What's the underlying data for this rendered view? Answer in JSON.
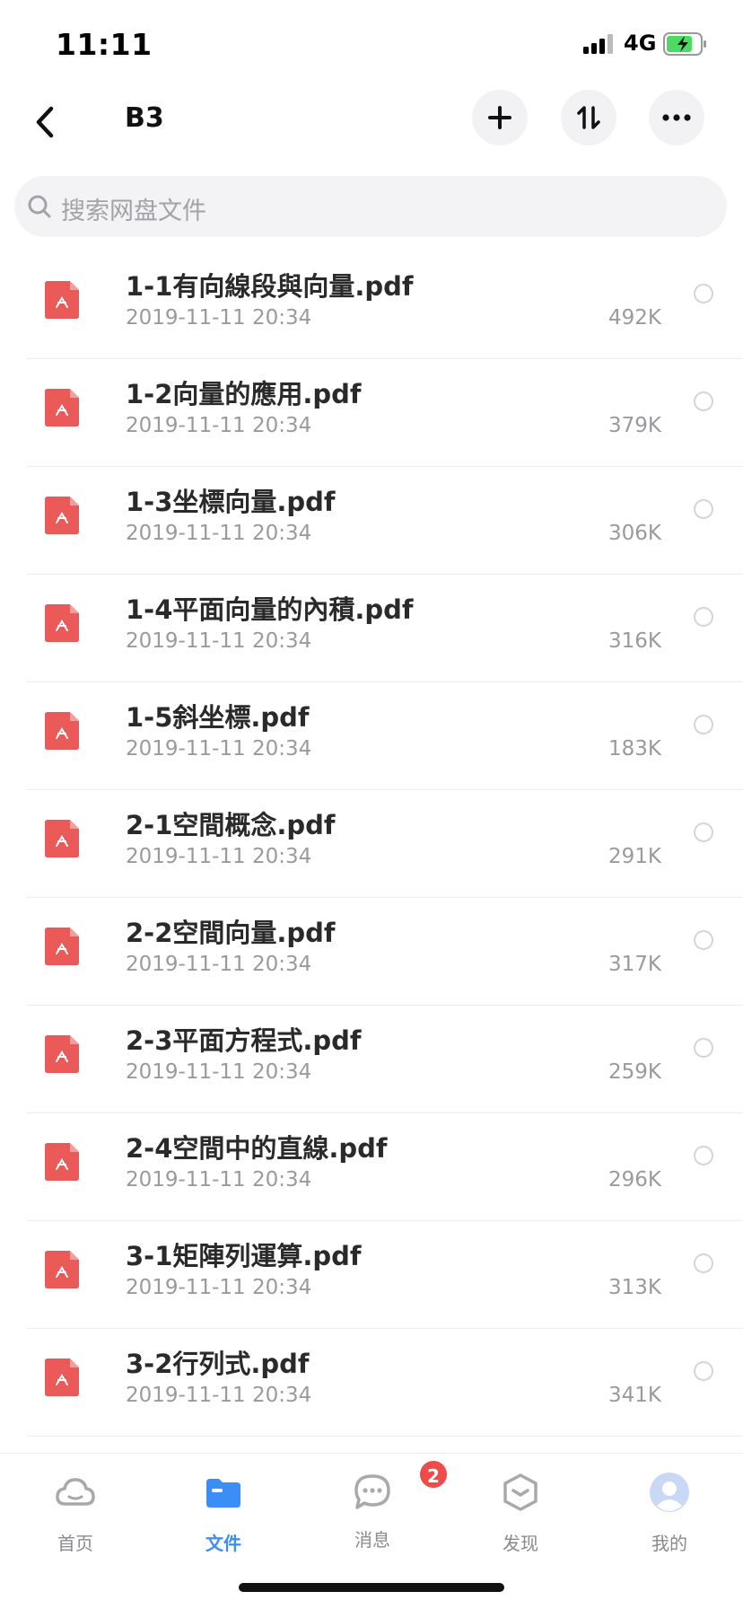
{
  "status_bar": {
    "time": "11:11",
    "network": "4G"
  },
  "nav": {
    "title": "B3"
  },
  "search": {
    "placeholder": "搜索网盘文件"
  },
  "files": [
    {
      "name": "1-1有向線段與向量.pdf",
      "date": "2019-11-11 20:34",
      "size": "492K"
    },
    {
      "name": "1-2向量的應用.pdf",
      "date": "2019-11-11 20:34",
      "size": "379K"
    },
    {
      "name": "1-3坐標向量.pdf",
      "date": "2019-11-11 20:34",
      "size": "306K"
    },
    {
      "name": "1-4平面向量的內積.pdf",
      "date": "2019-11-11 20:34",
      "size": "316K"
    },
    {
      "name": "1-5斜坐標.pdf",
      "date": "2019-11-11 20:34",
      "size": "183K"
    },
    {
      "name": "2-1空間概念.pdf",
      "date": "2019-11-11 20:34",
      "size": "291K"
    },
    {
      "name": "2-2空間向量.pdf",
      "date": "2019-11-11 20:34",
      "size": "317K"
    },
    {
      "name": "2-3平面方程式.pdf",
      "date": "2019-11-11 20:34",
      "size": "259K"
    },
    {
      "name": "2-4空間中的直線.pdf",
      "date": "2019-11-11 20:34",
      "size": "296K"
    },
    {
      "name": "3-1矩陣列運算.pdf",
      "date": "2019-11-11 20:34",
      "size": "313K"
    },
    {
      "name": "3-2行列式.pdf",
      "date": "2019-11-11 20:34",
      "size": "341K"
    }
  ],
  "tabs": [
    {
      "label": "首页",
      "icon": "cloud-icon",
      "active": false
    },
    {
      "label": "文件",
      "icon": "folder-icon",
      "active": true
    },
    {
      "label": "消息",
      "icon": "chat-bubble-icon",
      "active": false,
      "badge": "2"
    },
    {
      "label": "发现",
      "icon": "discover-box-icon",
      "active": false
    },
    {
      "label": "我的",
      "icon": "avatar-icon",
      "active": false
    }
  ],
  "colors": {
    "accent": "#3b8ef5",
    "pdf_red": "#e95a58",
    "badge_red": "#ee4b4b"
  }
}
